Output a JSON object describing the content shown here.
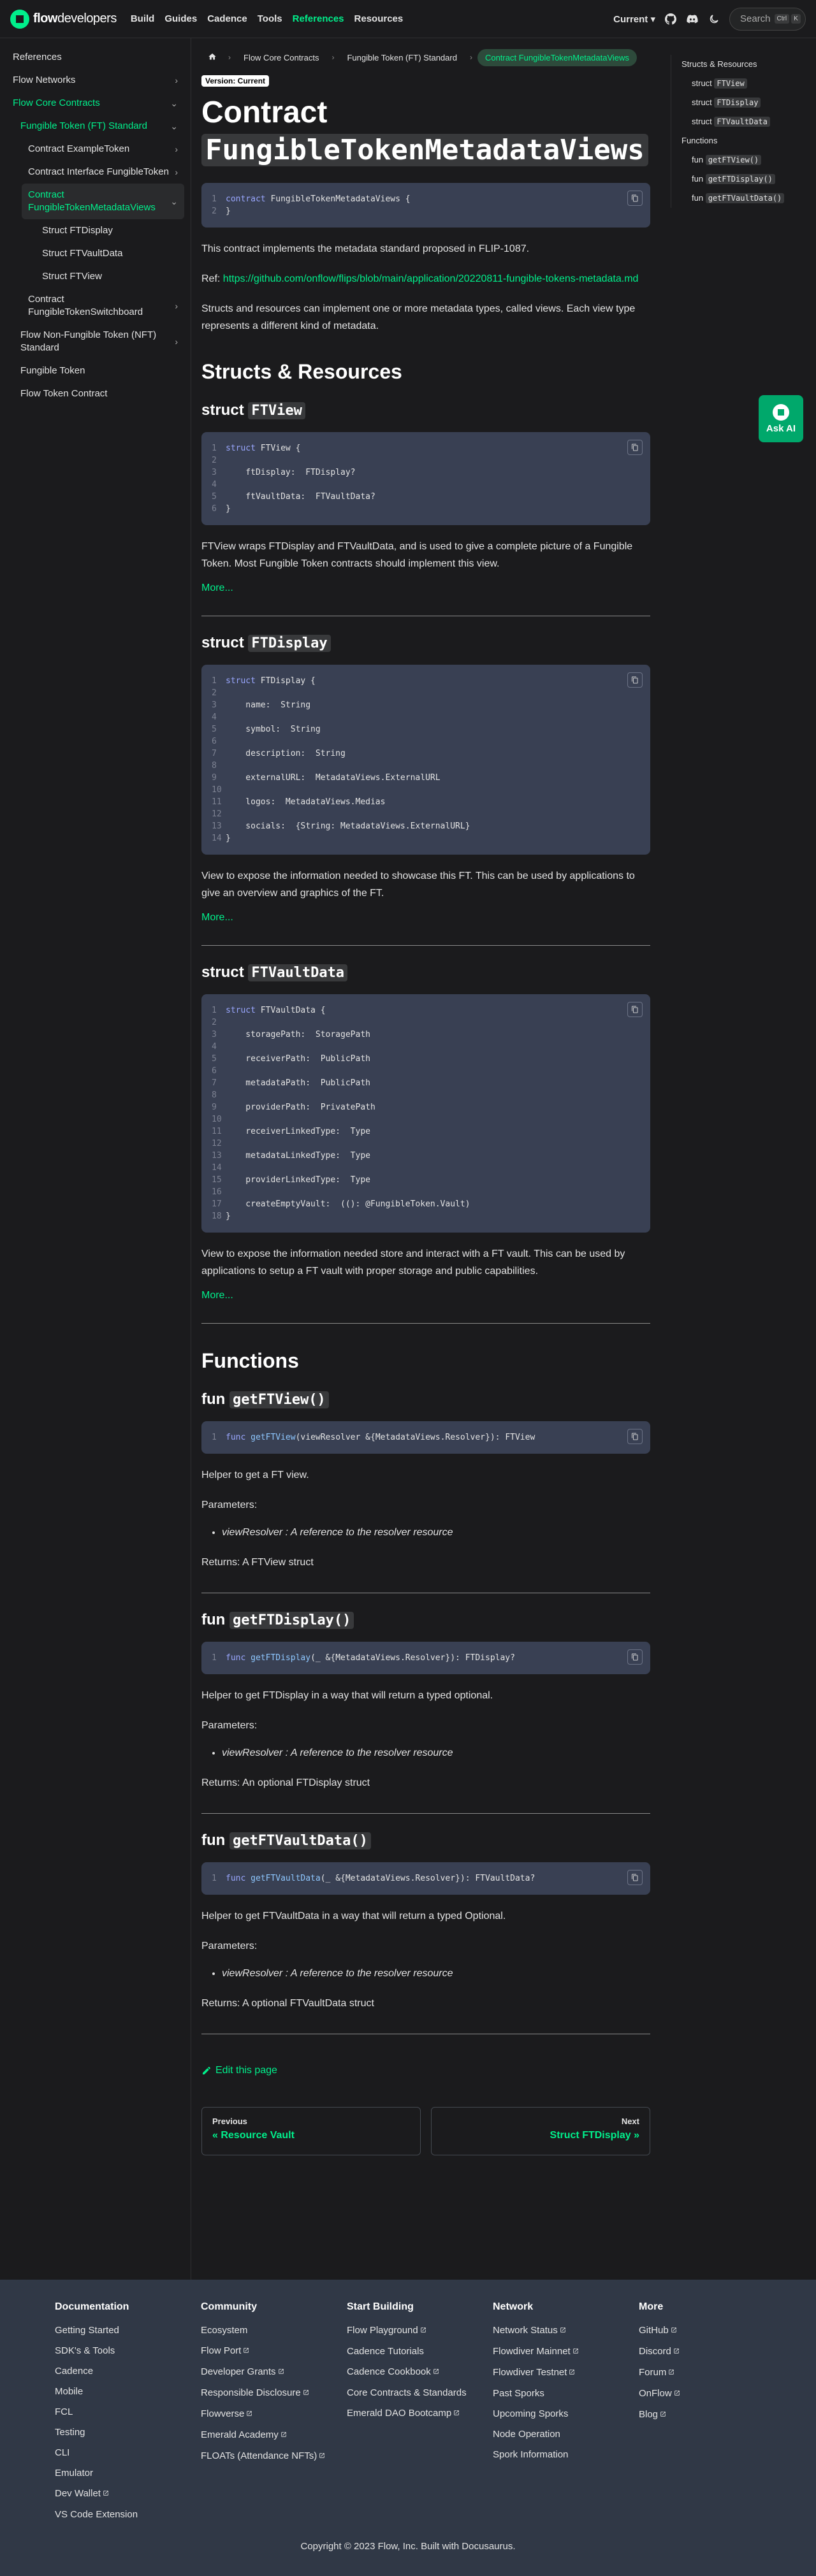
{
  "navbar": {
    "brand_strong": "flow",
    "brand_light": "developers",
    "links": [
      "Build",
      "Guides",
      "Cadence",
      "Tools",
      "References",
      "Resources"
    ],
    "active_index": 4,
    "version": "Current",
    "search_placeholder": "Search",
    "kbd": [
      "Ctrl",
      "K"
    ]
  },
  "sidebar": {
    "heading": "References",
    "items": [
      {
        "label": "Flow Networks",
        "level": 1,
        "chevron": "›"
      },
      {
        "label": "Flow Core Contracts",
        "level": 1,
        "chevron": "⌄",
        "state": "active"
      },
      {
        "label": "Fungible Token (FT) Standard",
        "level": 2,
        "chevron": "⌄",
        "state": "active"
      },
      {
        "label": "Contract ExampleToken",
        "level": 3,
        "chevron": "›"
      },
      {
        "label": "Contract Interface FungibleToken",
        "level": 3,
        "chevron": "›"
      },
      {
        "label": "Contract FungibleTokenMetadataViews",
        "level": 3,
        "chevron": "⌄",
        "state": "current"
      },
      {
        "label": "Struct FTDisplay",
        "level": 4
      },
      {
        "label": "Struct FTVaultData",
        "level": 4
      },
      {
        "label": "Struct FTView",
        "level": 4
      },
      {
        "label": "Contract FungibleTokenSwitchboard",
        "level": 3,
        "chevron": "›"
      },
      {
        "label": "Flow Non-Fungible Token (NFT) Standard",
        "level": 2,
        "chevron": "›"
      },
      {
        "label": "Fungible Token",
        "level": 2
      },
      {
        "label": "Flow Token Contract",
        "level": 2
      }
    ]
  },
  "breadcrumbs": {
    "items": [
      "Flow Core Contracts",
      "Fungible Token (FT) Standard",
      "Contract FungibleTokenMetadataViews"
    ]
  },
  "page": {
    "version_badge": "Version: Current",
    "title_prefix": "Contract",
    "title_code": "FungibleTokenMetadataViews",
    "contract_code": [
      [
        {
          "t": "contract",
          "c": "kw"
        },
        {
          "t": " FungibleTokenMetadataViews {"
        }
      ],
      [
        {
          "t": "}"
        }
      ]
    ],
    "intro1": "This contract implements the metadata standard proposed in FLIP-1087.",
    "ref_label": "Ref: ",
    "ref_link": "https://github.com/onflow/flips/blob/main/application/20220811-fungible-tokens-metadata.md",
    "intro2": "Structs and resources can implement one or more metadata types, called views. Each view type represents a different kind of metadata.",
    "structs_heading": "Structs & Resources",
    "structs": [
      {
        "keyword": "struct",
        "name": "FTView",
        "code": [
          [
            {
              "t": "struct",
              "c": "kw"
            },
            {
              "t": " FTView {"
            }
          ],
          [
            {
              "t": ""
            }
          ],
          [
            {
              "t": "    ftDisplay:  FTDisplay?"
            }
          ],
          [
            {
              "t": ""
            }
          ],
          [
            {
              "t": "    ftVaultData:  FTVaultData?"
            }
          ],
          [
            {
              "t": "}"
            }
          ]
        ],
        "description": "FTView wraps FTDisplay and FTVaultData, and is used to give a complete picture of a Fungible Token. Most Fungible Token contracts should implement this view.",
        "more": "More..."
      },
      {
        "keyword": "struct",
        "name": "FTDisplay",
        "code": [
          [
            {
              "t": "struct",
              "c": "kw"
            },
            {
              "t": " FTDisplay {"
            }
          ],
          [
            {
              "t": ""
            }
          ],
          [
            {
              "t": "    name:  String"
            }
          ],
          [
            {
              "t": ""
            }
          ],
          [
            {
              "t": "    symbol:  String"
            }
          ],
          [
            {
              "t": ""
            }
          ],
          [
            {
              "t": "    description:  String"
            }
          ],
          [
            {
              "t": ""
            }
          ],
          [
            {
              "t": "    externalURL:  MetadataViews.ExternalURL"
            }
          ],
          [
            {
              "t": ""
            }
          ],
          [
            {
              "t": "    logos:  MetadataViews.Medias"
            }
          ],
          [
            {
              "t": ""
            }
          ],
          [
            {
              "t": "    socials:  {String: MetadataViews.ExternalURL}"
            }
          ],
          [
            {
              "t": "}"
            }
          ]
        ],
        "description": "View to expose the information needed to showcase this FT. This can be used by applications to give an overview and graphics of the FT.",
        "more": "More..."
      },
      {
        "keyword": "struct",
        "name": "FTVaultData",
        "code": [
          [
            {
              "t": "struct",
              "c": "kw"
            },
            {
              "t": " FTVaultData {"
            }
          ],
          [
            {
              "t": ""
            }
          ],
          [
            {
              "t": "    storagePath:  StoragePath"
            }
          ],
          [
            {
              "t": ""
            }
          ],
          [
            {
              "t": "    receiverPath:  PublicPath"
            }
          ],
          [
            {
              "t": ""
            }
          ],
          [
            {
              "t": "    metadataPath:  PublicPath"
            }
          ],
          [
            {
              "t": ""
            }
          ],
          [
            {
              "t": "    providerPath:  PrivatePath"
            }
          ],
          [
            {
              "t": ""
            }
          ],
          [
            {
              "t": "    receiverLinkedType:  Type"
            }
          ],
          [
            {
              "t": ""
            }
          ],
          [
            {
              "t": "    metadataLinkedType:  Type"
            }
          ],
          [
            {
              "t": ""
            }
          ],
          [
            {
              "t": "    providerLinkedType:  Type"
            }
          ],
          [
            {
              "t": ""
            }
          ],
          [
            {
              "t": "    createEmptyVault:  ((): @FungibleToken.Vault)"
            }
          ],
          [
            {
              "t": "}"
            }
          ]
        ],
        "description": "View to expose the information needed store and interact with a FT vault. This can be used by applications to setup a FT vault with proper storage and public capabilities.",
        "more": "More..."
      }
    ],
    "functions_heading": "Functions",
    "functions": [
      {
        "keyword": "fun",
        "name": "getFTView()",
        "code": [
          [
            {
              "t": "func ",
              "c": "kw"
            },
            {
              "t": "getFTView",
              "c": "fn"
            },
            {
              "t": "(viewResolver &{MetadataViews.Resolver}): FTView"
            }
          ]
        ],
        "description": "Helper to get a FT view.",
        "params_label": "Parameters:",
        "param_name": "viewResolver",
        "param_desc": " : A reference to the resolver resource",
        "returns": "Returns: A FTView struct"
      },
      {
        "keyword": "fun",
        "name": "getFTDisplay()",
        "code": [
          [
            {
              "t": "func ",
              "c": "kw"
            },
            {
              "t": "getFTDisplay",
              "c": "fn"
            },
            {
              "t": "(_ &{MetadataViews.Resolver}): FTDisplay?"
            }
          ]
        ],
        "description": "Helper to get FTDisplay in a way that will return a typed optional.",
        "params_label": "Parameters:",
        "param_name": "viewResolver",
        "param_desc": " : A reference to the resolver resource",
        "returns": "Returns: An optional FTDisplay struct"
      },
      {
        "keyword": "fun",
        "name": "getFTVaultData()",
        "code": [
          [
            {
              "t": "func ",
              "c": "kw"
            },
            {
              "t": "getFTVaultData",
              "c": "fn"
            },
            {
              "t": "(_ &{MetadataViews.Resolver}): FTVaultData?"
            }
          ]
        ],
        "description": "Helper to get FTVaultData in a way that will return a typed Optional.",
        "params_label": "Parameters:",
        "param_name": "viewResolver",
        "param_desc": " : A reference to the resolver resource",
        "returns": "Returns: A optional FTVaultData struct"
      }
    ],
    "edit_label": "Edit this page",
    "prev_sub": "Previous",
    "prev_title": "« Resource Vault",
    "next_sub": "Next",
    "next_title": "Struct FTDisplay »"
  },
  "toc": {
    "items": [
      {
        "text": "Structs & Resources",
        "sub": false
      },
      {
        "pre": "struct ",
        "code": "FTView",
        "sub": true
      },
      {
        "pre": "struct ",
        "code": "FTDisplay",
        "sub": true
      },
      {
        "pre": "struct ",
        "code": "FTVaultData",
        "sub": true
      },
      {
        "text": "Functions",
        "sub": false
      },
      {
        "pre": "fun ",
        "code": "getFTView()",
        "sub": true
      },
      {
        "pre": "fun ",
        "code": "getFTDisplay()",
        "sub": true
      },
      {
        "pre": "fun ",
        "code": "getFTVaultData()",
        "sub": true
      }
    ]
  },
  "ask_ai": "Ask AI",
  "footer": {
    "columns": [
      {
        "title": "Documentation",
        "links": [
          {
            "t": "Getting Started"
          },
          {
            "t": "SDK's & Tools"
          },
          {
            "t": "Cadence"
          },
          {
            "t": "Mobile"
          },
          {
            "t": "FCL"
          },
          {
            "t": "Testing"
          },
          {
            "t": "CLI"
          },
          {
            "t": "Emulator"
          },
          {
            "t": "Dev Wallet",
            "ext": true
          },
          {
            "t": "VS Code Extension"
          }
        ]
      },
      {
        "title": "Community",
        "links": [
          {
            "t": "Ecosystem"
          },
          {
            "t": "Flow Port",
            "ext": true
          },
          {
            "t": "Developer Grants",
            "ext": true
          },
          {
            "t": "Responsible Disclosure",
            "ext": true
          },
          {
            "t": "Flowverse",
            "ext": true
          },
          {
            "t": "Emerald Academy",
            "ext": true
          },
          {
            "t": "FLOATs (Attendance NFTs)",
            "ext": true
          }
        ]
      },
      {
        "title": "Start Building",
        "links": [
          {
            "t": "Flow Playground",
            "ext": true
          },
          {
            "t": "Cadence Tutorials"
          },
          {
            "t": "Cadence Cookbook",
            "ext": true
          },
          {
            "t": "Core Contracts & Standards"
          },
          {
            "t": "Emerald DAO Bootcamp",
            "ext": true
          }
        ]
      },
      {
        "title": "Network",
        "links": [
          {
            "t": "Network Status",
            "ext": true
          },
          {
            "t": "Flowdiver Mainnet",
            "ext": true
          },
          {
            "t": "Flowdiver Testnet",
            "ext": true
          },
          {
            "t": "Past Sporks"
          },
          {
            "t": "Upcoming Sporks"
          },
          {
            "t": "Node Operation"
          },
          {
            "t": "Spork Information"
          }
        ]
      },
      {
        "title": "More",
        "links": [
          {
            "t": "GitHub",
            "ext": true
          },
          {
            "t": "Discord",
            "ext": true
          },
          {
            "t": "Forum",
            "ext": true
          },
          {
            "t": "OnFlow",
            "ext": true
          },
          {
            "t": "Blog",
            "ext": true
          }
        ]
      }
    ],
    "copyright": "Copyright © 2023 Flow, Inc. Built with Docusaurus."
  },
  "icons": {
    "github": "github-icon",
    "discord": "discord-icon",
    "theme": "moon-icon",
    "search": "search-icon",
    "external": "external-link-icon",
    "copy": "copy-icon",
    "home": "home-icon",
    "edit": "pencil-icon"
  },
  "colors": {
    "accent": "#00ef8b",
    "background": "#1b1b1d",
    "code_bg": "#394053",
    "footer_bg": "#303846"
  }
}
